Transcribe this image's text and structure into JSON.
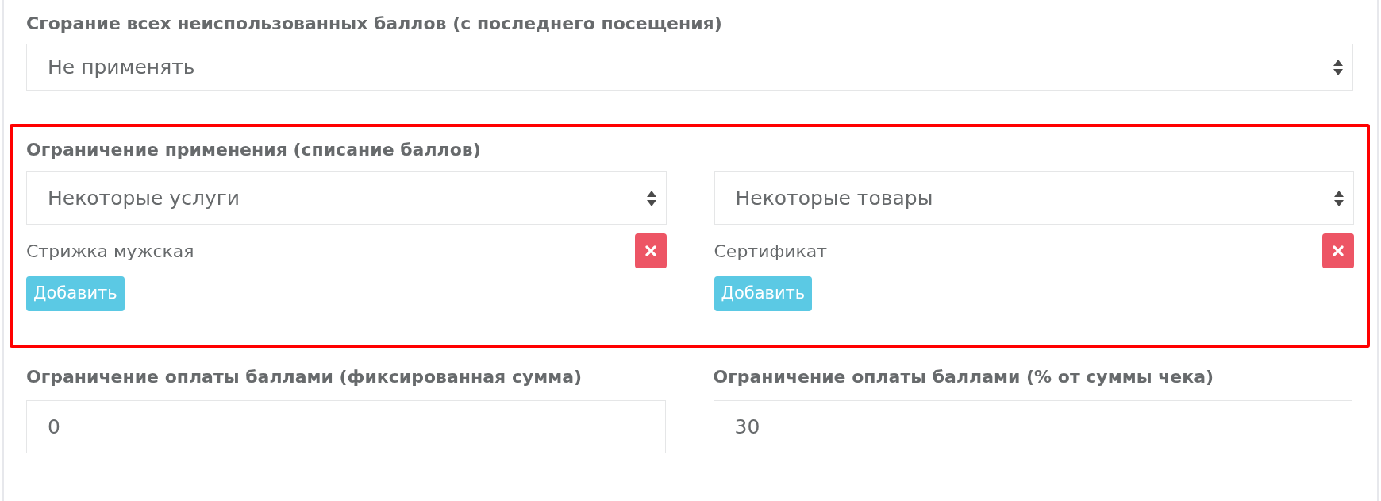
{
  "expiry": {
    "label": "Сгорание всех неиспользованных баллов (с последнего посещения)",
    "value": "Не применять"
  },
  "restriction": {
    "highlighted": true,
    "title": "Ограничение применения (списание баллов)",
    "columns": [
      {
        "value": "Некоторые услуги",
        "items": [
          {
            "name": "Стрижка мужская"
          }
        ],
        "add_button": "Добавить"
      },
      {
        "value": "Некоторые товары",
        "items": [
          {
            "name": "Сертификат"
          }
        ],
        "add_button": "Добавить"
      }
    ]
  },
  "limits": [
    {
      "label": "Ограничение оплаты баллами (фиксированная сумма)",
      "value": "0"
    },
    {
      "label": "Ограничение оплаты баллами (% от суммы чека)",
      "value": "30"
    }
  ]
}
